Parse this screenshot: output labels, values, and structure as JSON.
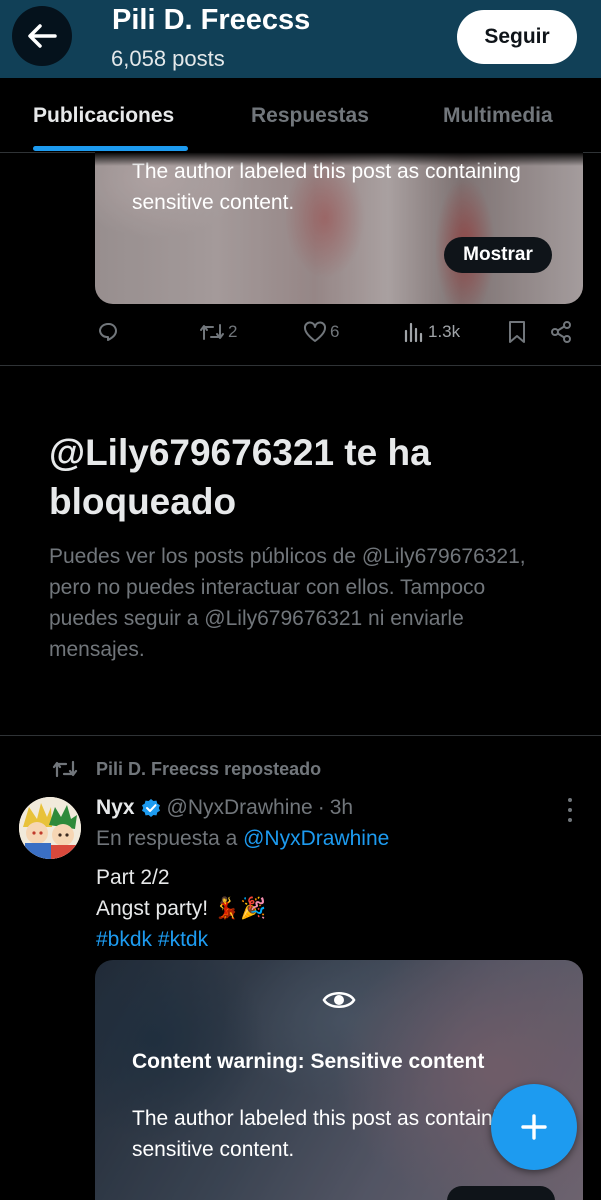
{
  "header": {
    "back_icon": "arrow-left-icon",
    "profile_name": "Pili D. Freecss",
    "posts_count": "6,058 posts",
    "follow_label": "Seguir",
    "bg_color": "#114057"
  },
  "tabs": [
    {
      "label": "Publicaciones",
      "active": true
    },
    {
      "label": "Respuestas",
      "active": false
    },
    {
      "label": "Multimedia",
      "active": false
    }
  ],
  "post1": {
    "sensitive_text": "The author labeled this post as containing sensitive content.",
    "show_label": "Mostrar",
    "actions": {
      "reply_icon": "reply-icon",
      "repost_icon": "repost-icon",
      "repost_count": "2",
      "like_icon": "heart-icon",
      "like_count": "6",
      "views_icon": "views-icon",
      "views_count": "1.3k",
      "bookmark_icon": "bookmark-icon",
      "share_icon": "share-icon"
    }
  },
  "blocked": {
    "title": "@Lily679676321 te ha bloqueado",
    "description": "Puedes ver los posts públicos de @Lily679676321, pero no puedes interactuar con ellos. Tampoco puedes seguir a @Lily679676321 ni enviarle mensajes."
  },
  "post2": {
    "repost_label": "Pili D. Freecss reposteado",
    "author_name": "Nyx",
    "verified_icon": "verified-badge-icon",
    "handle": "@NyxDrawhine",
    "separator": "·",
    "time": "3h",
    "reply_prefix": "En respuesta a",
    "reply_to": "@NyxDrawhine",
    "lines": [
      "Part 2/2",
      "Angst party! 💃🎉"
    ],
    "hashtags": [
      "#bkdk",
      "#ktdk"
    ],
    "warning_title": "Content warning: Sensitive content",
    "warning_text": "The author labeled this post as containing sensitive content."
  },
  "fab": {
    "icon": "plus-icon",
    "color": "#1d9bf0"
  },
  "colors": {
    "accent": "#1d9bf0",
    "muted": "#71767b",
    "text": "#e7e9ea",
    "background": "#000000"
  }
}
